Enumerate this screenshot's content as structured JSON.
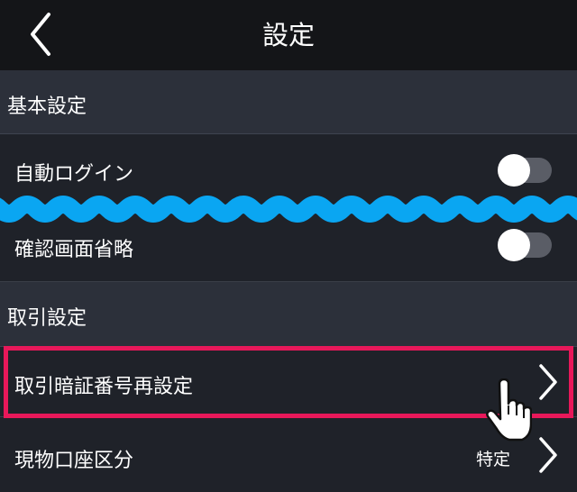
{
  "header": {
    "title": "設定",
    "back_icon": "chevron-left-icon"
  },
  "sections": [
    {
      "label": "基本設定",
      "rows": [
        {
          "label": "自動ログイン",
          "control": "toggle",
          "on": false
        },
        {
          "label": "確認画面省略",
          "control": "toggle",
          "on": false
        }
      ]
    },
    {
      "label": "取引設定",
      "rows": [
        {
          "label": "取引暗証番号再設定",
          "control": "chevron",
          "highlighted": true
        },
        {
          "label": "現物口座区分",
          "control": "chevron",
          "value": "特定"
        }
      ]
    }
  ],
  "colors": {
    "header_bg": "#141518",
    "section_bg": "#2c303a",
    "row_bg": "#1f2229",
    "highlight": "#e8185a",
    "wave": "#0aa6f2",
    "toggle_track": "#5a5d66"
  }
}
